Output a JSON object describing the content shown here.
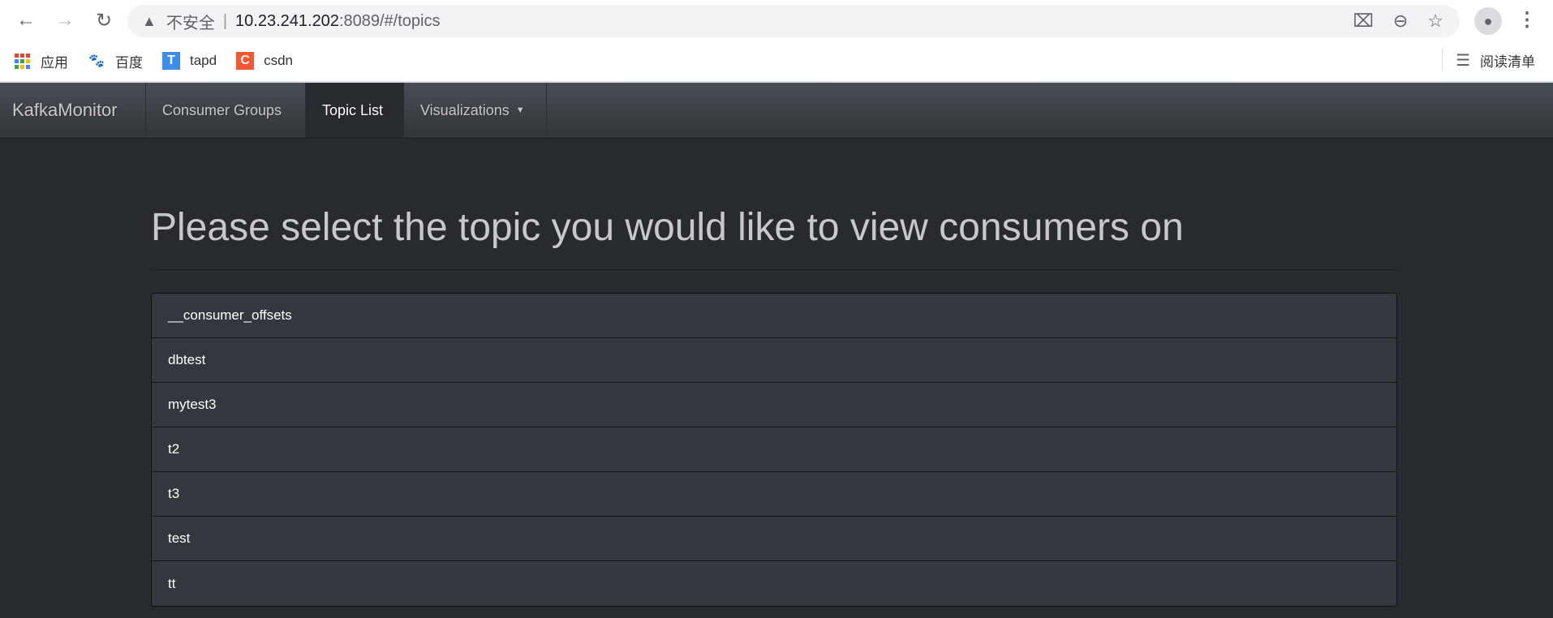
{
  "browser": {
    "security_label": "不安全",
    "url_host": "10.23.241.202",
    "url_path": ":8089/#/topics",
    "icons": [
      "back-icon",
      "forward-icon",
      "reload-icon",
      "warning-icon",
      "translate-icon",
      "zoom-out-icon",
      "star-icon",
      "profile-icon",
      "menu-icon"
    ],
    "bookmarks": [
      {
        "label": "应用",
        "icon": "apps-icon"
      },
      {
        "label": "百度",
        "icon": "baidu-icon"
      },
      {
        "label": "tapd",
        "icon": "tapd-icon"
      },
      {
        "label": "csdn",
        "icon": "csdn-icon"
      }
    ],
    "reading_list": "阅读清单"
  },
  "navbar": {
    "brand": "KafkaMonitor",
    "items": [
      {
        "label": "Consumer Groups"
      },
      {
        "label": "Topic List",
        "active": true
      },
      {
        "label": "Visualizations"
      }
    ]
  },
  "main": {
    "title": "Please select the topic you would like to view consumers on",
    "topics": [
      "__consumer_offsets",
      "dbtest",
      "mytest3",
      "t2",
      "t3",
      "test",
      "tt"
    ]
  },
  "colors": {
    "background": "#272b30",
    "list_item": "#32383e",
    "navbar": "#3a3f44"
  }
}
